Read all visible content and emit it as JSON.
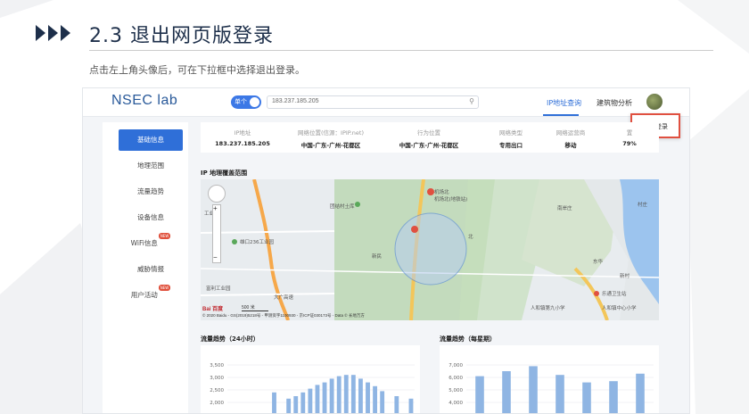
{
  "slide": {
    "title": "2.3 退出网页版登录",
    "subtitle": "点击左上角头像后，可在下拉框中选择退出登录。"
  },
  "app": {
    "logo": "NSEC lab",
    "toggle_label": "单个",
    "search_value": "183.237.185.205",
    "nav": [
      "IP地址查询",
      "建筑物分析"
    ],
    "dropdown_item": "退出登录"
  },
  "sidebar": {
    "items": [
      {
        "label": "基础信息",
        "active": true,
        "badge": ""
      },
      {
        "label": "地理范围",
        "active": false,
        "badge": ""
      },
      {
        "label": "流量趋势",
        "active": false,
        "badge": ""
      },
      {
        "label": "设备信息",
        "active": false,
        "badge": ""
      },
      {
        "label": "WiFi信息",
        "active": false,
        "badge": "NEW"
      },
      {
        "label": "威胁情报",
        "active": false,
        "badge": ""
      },
      {
        "label": "用户活动",
        "active": false,
        "badge": "NEW"
      }
    ]
  },
  "info": {
    "cells": [
      {
        "label": "IP地址",
        "value": "183.237.185.205"
      },
      {
        "label": "网络位置(信源：IPIP.net)",
        "value": "中国-广东-广州-花都区"
      },
      {
        "label": "行为位置",
        "value": "中国-广东-广州-花都区"
      },
      {
        "label": "网络类型",
        "value": "专用出口"
      },
      {
        "label": "网络运营商",
        "value": "移动"
      },
      {
        "label": "置",
        "value": "79%"
      }
    ]
  },
  "map": {
    "section_title": "IP 地理覆盖范围",
    "labels": [
      "团结村土库",
      "机场北",
      "机场北(地铁站)",
      "雄口236工业园",
      "工业园",
      "富利工业园",
      "大广高速",
      "新民",
      "北",
      "南岸庄",
      "村庄",
      "乐通卫生站",
      "人和镇中心小学",
      "人和镇第九小学",
      "东华",
      "新村"
    ],
    "scale": "500 米",
    "copyright": "© 2020 Baidu - GS(2019)5218号 - 甲测资字1100930 - 京ICP证030173号 - Data © 长地万方",
    "baidu_logo": "Bai 百度"
  },
  "charts": [
    {
      "section_title": "流量趋势（24小时）",
      "chart_data": {
        "type": "bar",
        "title": "流量趋势（24小时）",
        "yticks": [
          "3,500",
          "3,000",
          "2,500",
          "2,000"
        ],
        "ylim": [
          2000,
          3500
        ],
        "values": [
          null,
          null,
          null,
          null,
          null,
          null,
          2400,
          null,
          2150,
          2250,
          2400,
          2550,
          2700,
          2800,
          2950,
          3050,
          3100,
          3100,
          2950,
          2800,
          2650,
          2450,
          null,
          2250,
          null,
          2150
        ]
      }
    },
    {
      "section_title": "流量趋势（每星期）",
      "chart_data": {
        "type": "bar",
        "title": "流量趋势（每星期）",
        "yticks": [
          "7,000",
          "6,000",
          "5,000",
          "4,000"
        ],
        "ylim": [
          4000,
          7000
        ],
        "values": [
          6100,
          6500,
          6900,
          6200,
          5600,
          5700,
          6300
        ]
      }
    }
  ],
  "colors": {
    "accent": "#2f6fd8",
    "bar": "#8fb5e3",
    "highlight": "#e05040",
    "title": "#1d2f4a"
  }
}
